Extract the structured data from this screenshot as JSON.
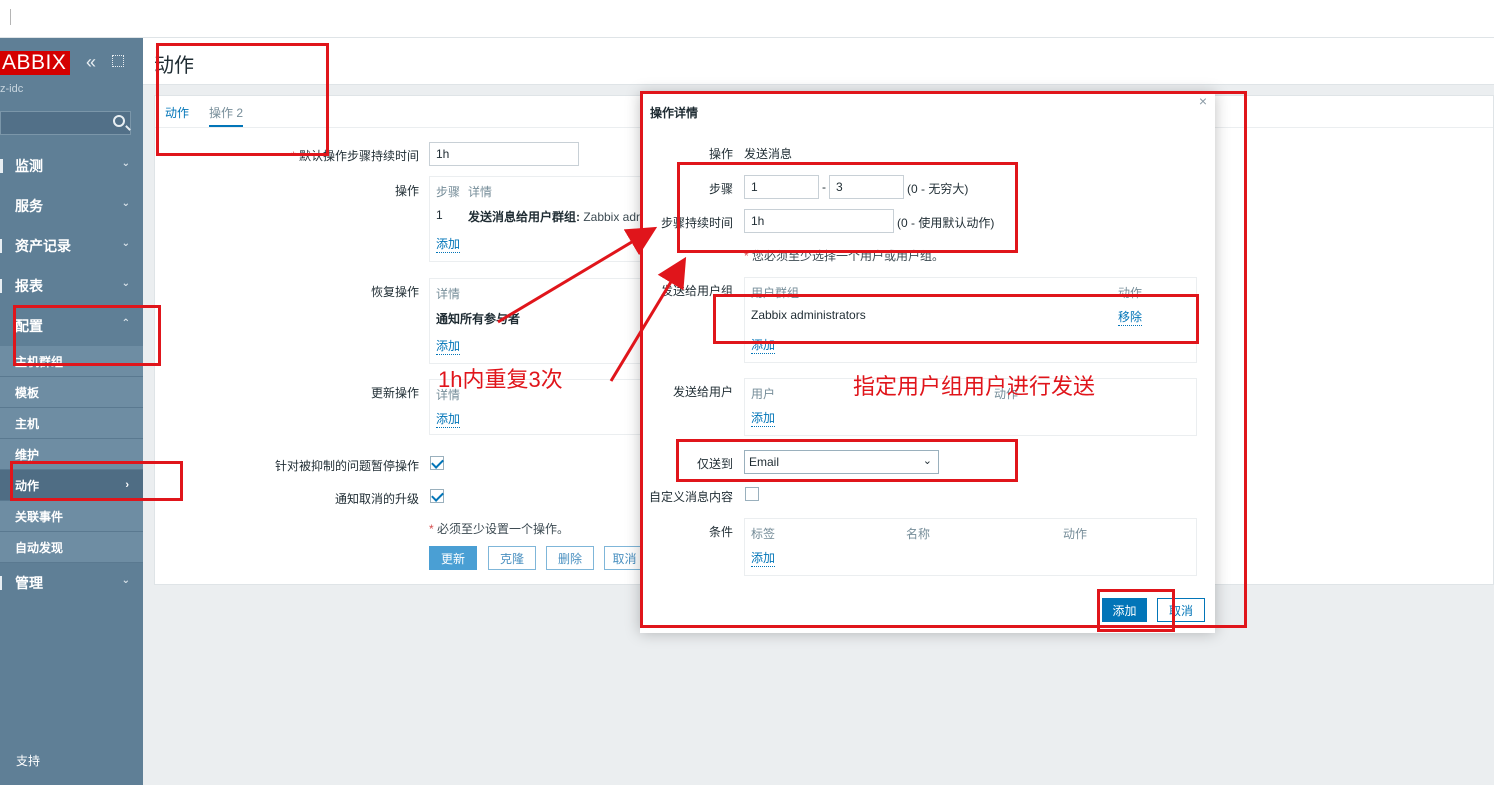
{
  "sidebar": {
    "logo": "ABBIX",
    "server_name": "z-idc",
    "menu": [
      {
        "label": "监测"
      },
      {
        "label": "服务"
      },
      {
        "label": "资产记录"
      },
      {
        "label": "报表"
      },
      {
        "label": "配置"
      }
    ],
    "submenu": [
      {
        "label": "主机群组"
      },
      {
        "label": "模板"
      },
      {
        "label": "主机"
      },
      {
        "label": "维护"
      },
      {
        "label": "动作"
      },
      {
        "label": "关联事件"
      },
      {
        "label": "自动发现"
      }
    ],
    "admin": "管理",
    "support": "支持"
  },
  "page": {
    "title": "动作",
    "tabs": [
      {
        "label": "动作"
      },
      {
        "label": "操作",
        "count": "2"
      }
    ]
  },
  "form": {
    "default_duration_label": "默认操作步骤持续时间",
    "default_duration_value": "1h",
    "operations_label": "操作",
    "operations_col_steps": "步骤",
    "operations_col_details": "详情",
    "operations_row_step": "1",
    "operations_row_detail_bold": "发送消息给用户群组:",
    "operations_row_detail_rest": " Zabbix adr",
    "add": "添加",
    "recovery_label": "恢复操作",
    "recovery_col": "详情",
    "recovery_row": "通知所有参与者",
    "update_label": "更新操作",
    "update_col": "详情",
    "pause_suppressed_label": "针对被抑制的问题暂停操作",
    "notify_cancelled_label": "通知取消的升级",
    "at_least_one": "必须至少设置一个操作。",
    "btn_update": "更新",
    "btn_clone": "克隆",
    "btn_delete": "删除",
    "btn_cancel": "取消"
  },
  "modal": {
    "title": "操作详情",
    "operation_label": "操作",
    "operation_value": "发送消息",
    "steps_label": "步骤",
    "steps_from": "1",
    "steps_to": "3",
    "steps_hint": "(0 - 无穷大)",
    "duration_label": "步骤持续时间",
    "duration_value": "1h",
    "duration_hint": "(0 - 使用默认动作)",
    "must_select": "您必须至少选择一个用户或用户组。",
    "send_groups_label": "发送给用户组",
    "groups_col_group": "用户群组",
    "groups_col_action": "动作",
    "group_name": "Zabbix administrators",
    "group_remove": "移除",
    "add": "添加",
    "send_users_label": "发送给用户",
    "users_col_user": "用户",
    "users_col_action": "动作",
    "send_only_to_label": "仅送到",
    "send_only_to_value": "Email",
    "custom_message_label": "自定义消息内容",
    "conditions_label": "条件",
    "cond_col_label": "标签",
    "cond_col_name": "名称",
    "cond_col_action": "动作",
    "btn_add": "添加",
    "btn_cancel": "取消"
  },
  "annotations": {
    "repeat_note": "1h内重复3次",
    "group_note": "指定用户组用户进行发送"
  },
  "colors": {
    "sidebar_bg": "#5f7f96",
    "accent": "#0275b8",
    "annotation_red": "#e0151b",
    "logo_red": "#d40000"
  }
}
